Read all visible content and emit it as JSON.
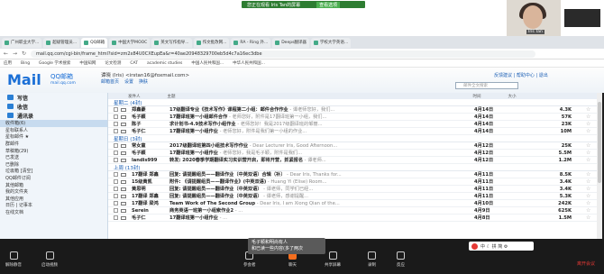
{
  "meeting_bar": {
    "title": "您正在观看 Iris Tan的屏幕",
    "view": "查看选项"
  },
  "webcam": {
    "name": "Iris Tan"
  },
  "browser": {
    "tabs": [
      "广州职业大学...",
      "超级管理员...",
      "QQ邮箱",
      "中国大学MOOC",
      "英文写作指导...",
      "作文批改网...",
      "RA - Ring 外...",
      "Deeps翻译器",
      "学校大学英语..."
    ],
    "url": "mail.qq.com/cgi-bin/frame_html?sid=zm2x84U0CXEupEa&r=40ae20948329700eb5d4c7a16ec3dbe",
    "bookmarks": [
      "应用",
      "Bing",
      "Google 学术搜索",
      "中国知网",
      "论文检测",
      "CAT",
      "academic studies",
      "中国人民共和国...",
      "中华人民共和国..."
    ]
  },
  "mail_header": {
    "logo": "Mail",
    "logo_cn": "QQ邮箱",
    "logo_url": "mail.qq.com",
    "user": "谭晓 (Iris) <irstan16@foxmail.com>",
    "links": [
      "邮箱首页",
      "设置",
      "换肤"
    ],
    "search_placeholder": "邮件全文搜索",
    "right_links": "反馈建议 | 帮助中心 | 退出"
  },
  "sidebar": {
    "buttons": [
      "写信",
      "收信",
      "通讯录"
    ],
    "folders": [
      "收件箱(6)",
      "星标联系人",
      "星标邮件 ★",
      "群邮件",
      "草稿箱(29)",
      "已发送",
      "已删除",
      "垃圾箱 [清空]",
      "QQ邮件订阅",
      "其他邮箱",
      "我的文件夹",
      "其他应用",
      "日历 | 记事本",
      "在线文档"
    ]
  },
  "list": {
    "columns": [
      "发件人",
      "主题",
      "时间",
      "大小"
    ],
    "groups": [
      {
        "label": "星期二 (4封)",
        "rows": [
          {
            "sender": "郑鑫豪",
            "subject": "17级翻译专业《技术写作》课程第二小组：邮件合作作业",
            "preview": "- 谭老师您好，我们...",
            "date": "4月14日",
            "size": "4.3K"
          },
          {
            "sender": "毛子颖",
            "subject": "17翻译班第一小组邮件合作",
            "preview": "- 老师您好，附件是17翻译班第一小组，我们...",
            "date": "4月14日",
            "size": "57K"
          },
          {
            "sender": "陈子",
            "subject": "求计划书-4.9技术写作小组作业",
            "preview": "- 老师您好！我是2017级翻译班的邹丽...",
            "date": "4月14日",
            "size": "23K"
          },
          {
            "sender": "毛子仁",
            "subject": "17翻译班第一小组作业",
            "preview": "- 老师您好，附件是我们第一小组的作业...",
            "date": "4月14日",
            "size": "10M"
          }
        ]
      },
      {
        "label": "星期日 (3封)",
        "rows": [
          {
            "sender": "常女童",
            "subject": "2017级翻译班第四小组技术写作作业",
            "preview": "- Dear Lecturer Iris, Good Afternoon...",
            "date": "4月12日",
            "size": "25K"
          },
          {
            "sender": "毛子颖",
            "subject": "17翻译班第一小组作业",
            "preview": "- 老师您好，我是毛子颖，附件是我们...",
            "date": "4月12日",
            "size": "5.5M"
          },
          {
            "sender": "landis999",
            "subject": "转发: 2020春季学期翻译实习实训营开启，即将开营，抓紧报名",
            "preview": "- 谭老师...",
            "date": "4月12日",
            "size": "1.2M"
          }
        ]
      },
      {
        "label": "上周 (13封)",
        "rows": [
          {
            "sender": "17翻译 郑鑫",
            "subject": "回复: 请提醒组员——翻译作业（中英双语）合辑（补）",
            "preview": "- Dear Iris, Thanks for...",
            "date": "4月11日",
            "size": "8.5K"
          },
          {
            "sender": "15级黄凯",
            "subject": "附件: 《请提醒组员——翻译作业》(中英双语)",
            "preview": "- Huang Yi (Elise) Room...",
            "date": "4月11日",
            "size": "3.4K"
          },
          {
            "sender": "黄思明",
            "subject": "回复: 请提醒组员——翻译作业（中英双语）",
            "preview": "- 谭老师，同学们已经...",
            "date": "4月11日",
            "size": "3.4K"
          },
          {
            "sender": "17翻译 郑鑫",
            "subject": "回复: 请提醒组员——翻译作业（中英双语）",
            "preview": "- 谭老师，感谢提醒...",
            "date": "4月11日",
            "size": "5.3K"
          },
          {
            "sender": "17翻译 梁鸿",
            "subject": "Team Work of The Second Group",
            "preview": "- Dear Iris, I am Xiong Qian of the...",
            "date": "4月10日",
            "size": "242K"
          },
          {
            "sender": "Serein",
            "subject": "商务英语一班第一小组索作业2",
            "preview": "- ...",
            "date": "4月9日",
            "size": "625K"
          },
          {
            "sender": "毛子仁",
            "subject": "17翻译班第一小组作业",
            "preview": "- ...",
            "date": "4月8日",
            "size": "1.5M"
          }
        ]
      }
    ]
  },
  "tooltip": {
    "line1": "毛子颖和明尚有人",
    "line2": "和已读一些内容(多了两次"
  },
  "taskbar": {
    "items": [
      "解除静音",
      "启动视频",
      "参会者",
      "聊天",
      "共享屏幕",
      "录制",
      "反应"
    ],
    "end": "离开会议",
    "participants": "1",
    "ime": "中 ☾ 拼 简 ⚙"
  }
}
